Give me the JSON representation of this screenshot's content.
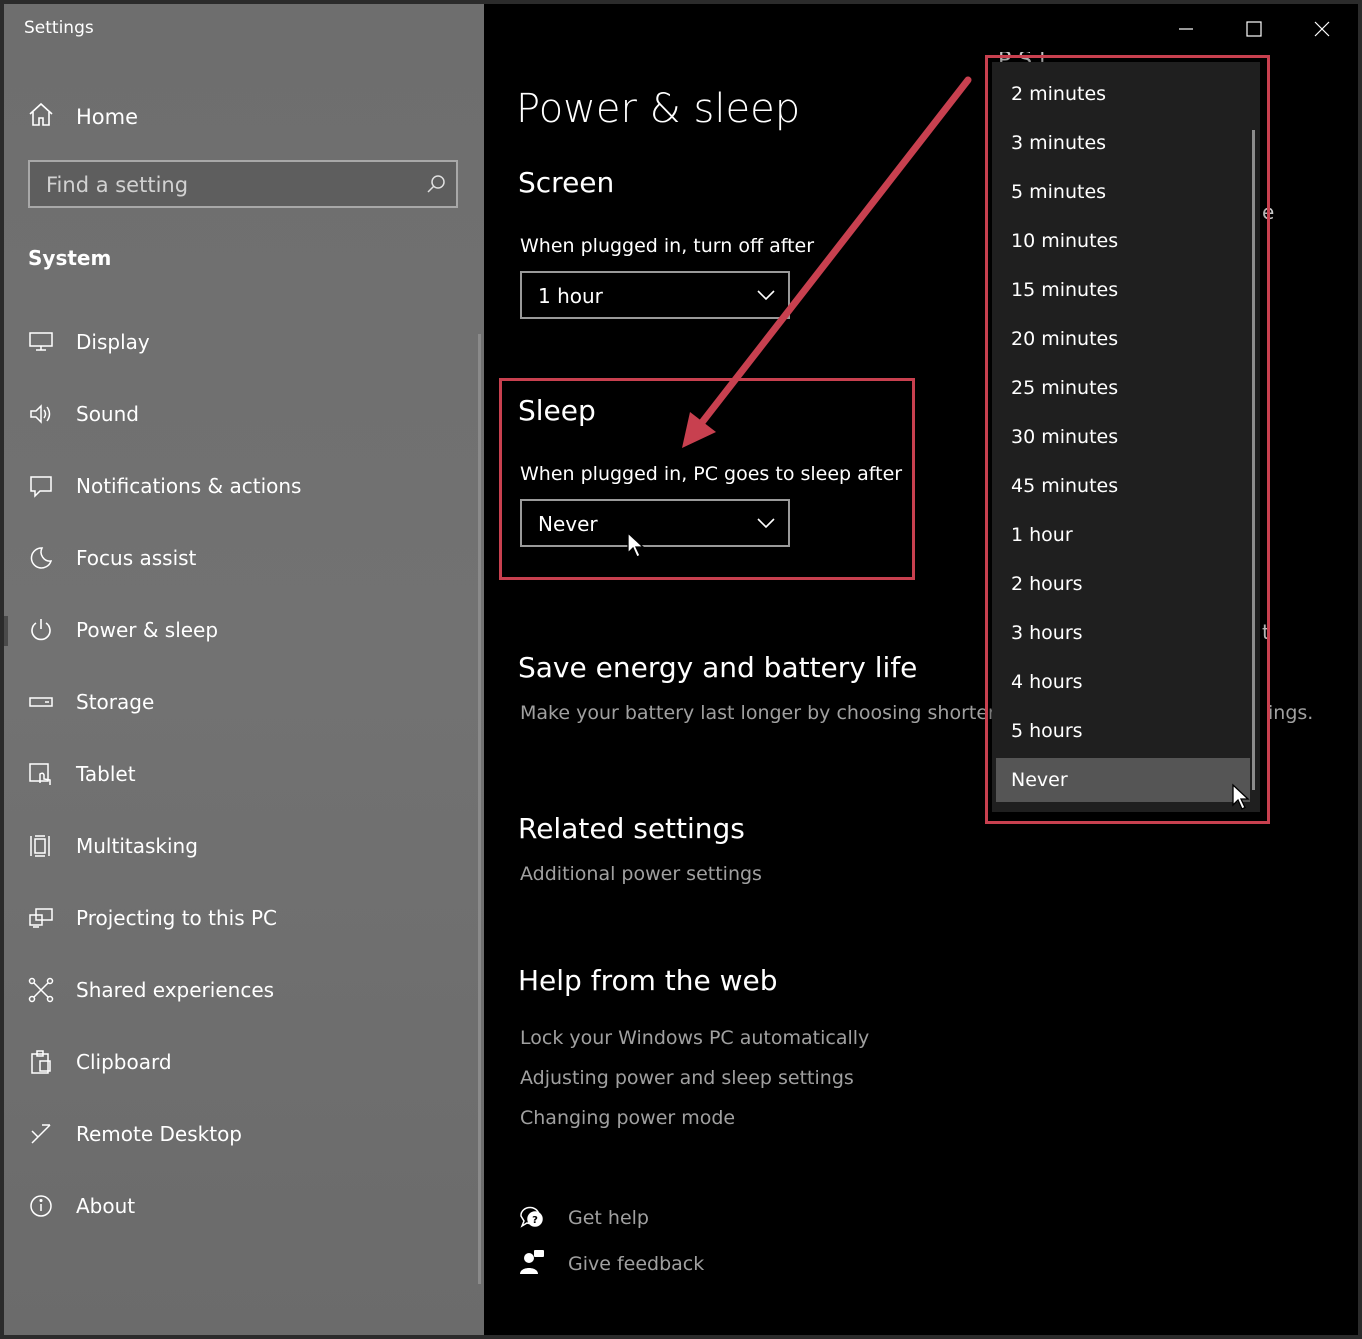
{
  "window": {
    "title": "Settings",
    "minimize_icon": "minimize-icon",
    "maximize_icon": "maximize-icon",
    "close_icon": "close-icon"
  },
  "sidebar": {
    "home_label": "Home",
    "search_placeholder": "Find a setting",
    "section_label": "System",
    "items": [
      {
        "label": "Display",
        "icon": "monitor-icon"
      },
      {
        "label": "Sound",
        "icon": "speaker-icon"
      },
      {
        "label": "Notifications & actions",
        "icon": "notification-icon"
      },
      {
        "label": "Focus assist",
        "icon": "moon-icon"
      },
      {
        "label": "Power & sleep",
        "icon": "power-icon",
        "active": true
      },
      {
        "label": "Storage",
        "icon": "storage-icon"
      },
      {
        "label": "Tablet",
        "icon": "tablet-icon"
      },
      {
        "label": "Multitasking",
        "icon": "multitasking-icon"
      },
      {
        "label": "Projecting to this PC",
        "icon": "projecting-icon"
      },
      {
        "label": "Shared experiences",
        "icon": "shared-icon"
      },
      {
        "label": "Clipboard",
        "icon": "clipboard-icon"
      },
      {
        "label": "Remote Desktop",
        "icon": "remote-desktop-icon"
      },
      {
        "label": "About",
        "icon": "info-icon"
      }
    ]
  },
  "main": {
    "title": "Power & sleep",
    "screen": {
      "heading": "Screen",
      "label": "When plugged in, turn off after",
      "value": "1 hour"
    },
    "sleep": {
      "heading": "Sleep",
      "label": "When plugged in, PC goes to sleep after",
      "value": "Never"
    },
    "save_energy": {
      "heading": "Save energy and battery life",
      "description": "Make your battery last longer by choosing shorter",
      "description_tail": "ings."
    },
    "related": {
      "heading": "Related settings",
      "link": "Additional power settings"
    },
    "help": {
      "heading": "Help from the web",
      "links": [
        "Lock your Windows PC automatically",
        "Adjusting power and sleep settings",
        "Changing power mode"
      ]
    },
    "get_help": "Get help",
    "give_feedback": "Give feedback"
  },
  "flyout": {
    "options": [
      "2 minutes",
      "3 minutes",
      "5 minutes",
      "10 minutes",
      "15 minutes",
      "20 minutes",
      "25 minutes",
      "30 minutes",
      "45 minutes",
      "1 hour",
      "2 hours",
      "3 hours",
      "4 hours",
      "5 hours",
      "Never"
    ],
    "selected": "Never"
  },
  "colors": {
    "annotation": "#c8404f",
    "sidebar_bg": "#707070",
    "main_bg": "#000000",
    "flyout_bg": "#1f1f1f",
    "link": "#a0a0a0"
  }
}
